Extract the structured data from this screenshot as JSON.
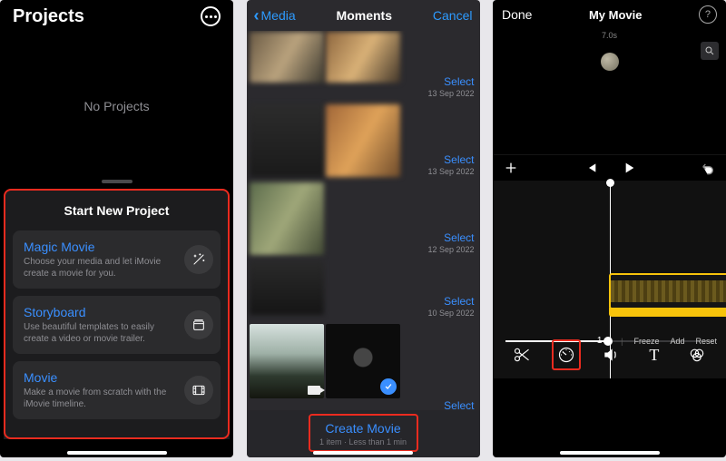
{
  "panel1": {
    "header_title": "Projects",
    "empty_text": "No Projects",
    "sheet_title": "Start New Project",
    "options": [
      {
        "title": "Magic Movie",
        "desc": "Choose your media and let iMovie create a movie for you.",
        "icon": "wand-icon"
      },
      {
        "title": "Storyboard",
        "desc": "Use beautiful templates to easily create a video or movie trailer.",
        "icon": "storyboard-icon"
      },
      {
        "title": "Movie",
        "desc": "Make a movie from scratch with the iMovie timeline.",
        "icon": "film-icon"
      }
    ]
  },
  "panel2": {
    "back_label": "Media",
    "title": "Moments",
    "cancel": "Cancel",
    "select_label": "Select",
    "rows": [
      {
        "date": "13 Sep 2022"
      },
      {
        "date": "13 Sep 2022"
      },
      {
        "date": "12 Sep 2022"
      },
      {
        "date": "10 Sep 2022"
      }
    ],
    "last_select": "Select",
    "create_label": "Create Movie",
    "create_sub": "1 item · Less than 1 min"
  },
  "panel3": {
    "done": "Done",
    "title": "My Movie",
    "help": "?",
    "timestamp": "7.0s",
    "speed_label": "1 ×",
    "freeze": "Freeze",
    "add": "Add",
    "reset": "Reset"
  }
}
